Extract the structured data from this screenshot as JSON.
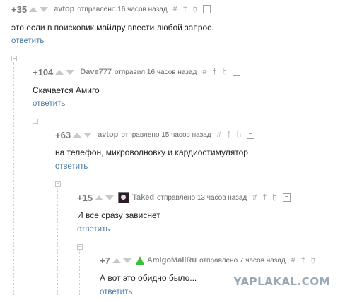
{
  "comments": [
    {
      "rating": "+35",
      "user": "avtop",
      "action": "отправлено 16 часов назад",
      "text": "это если в поисковик майлру ввести любой запрос.",
      "reply": "ответить"
    },
    {
      "rating": "+104",
      "user": "Dave777",
      "action": "отправил 16 часов назад",
      "text": "Скачается Амиго",
      "reply": "ответить"
    },
    {
      "rating": "+63",
      "user": "avtop",
      "action": "отправлено 15 часов назад",
      "text": "на телефон, микроволновку и кардиостимулятор",
      "reply": "ответить"
    },
    {
      "rating": "+15",
      "user": "Taked",
      "action": "отправлено 13 часов назад",
      "text": "И все сразу зависнет",
      "reply": "ответить"
    },
    {
      "rating": "+7",
      "user": "AmigoMailRu",
      "action": "отправлено 7 часов назад",
      "text": "А вот это обидно было...",
      "reply": "ответить"
    }
  ],
  "icons": {
    "hash": "#",
    "pin": "†",
    "reply_arrow": "ḥ"
  },
  "watermark": "YAPLAKAL.COM",
  "colors": {
    "link": "#4a7aa6",
    "rating": "#777777",
    "meta": "#666666",
    "watermark": "#9aa9b6"
  }
}
